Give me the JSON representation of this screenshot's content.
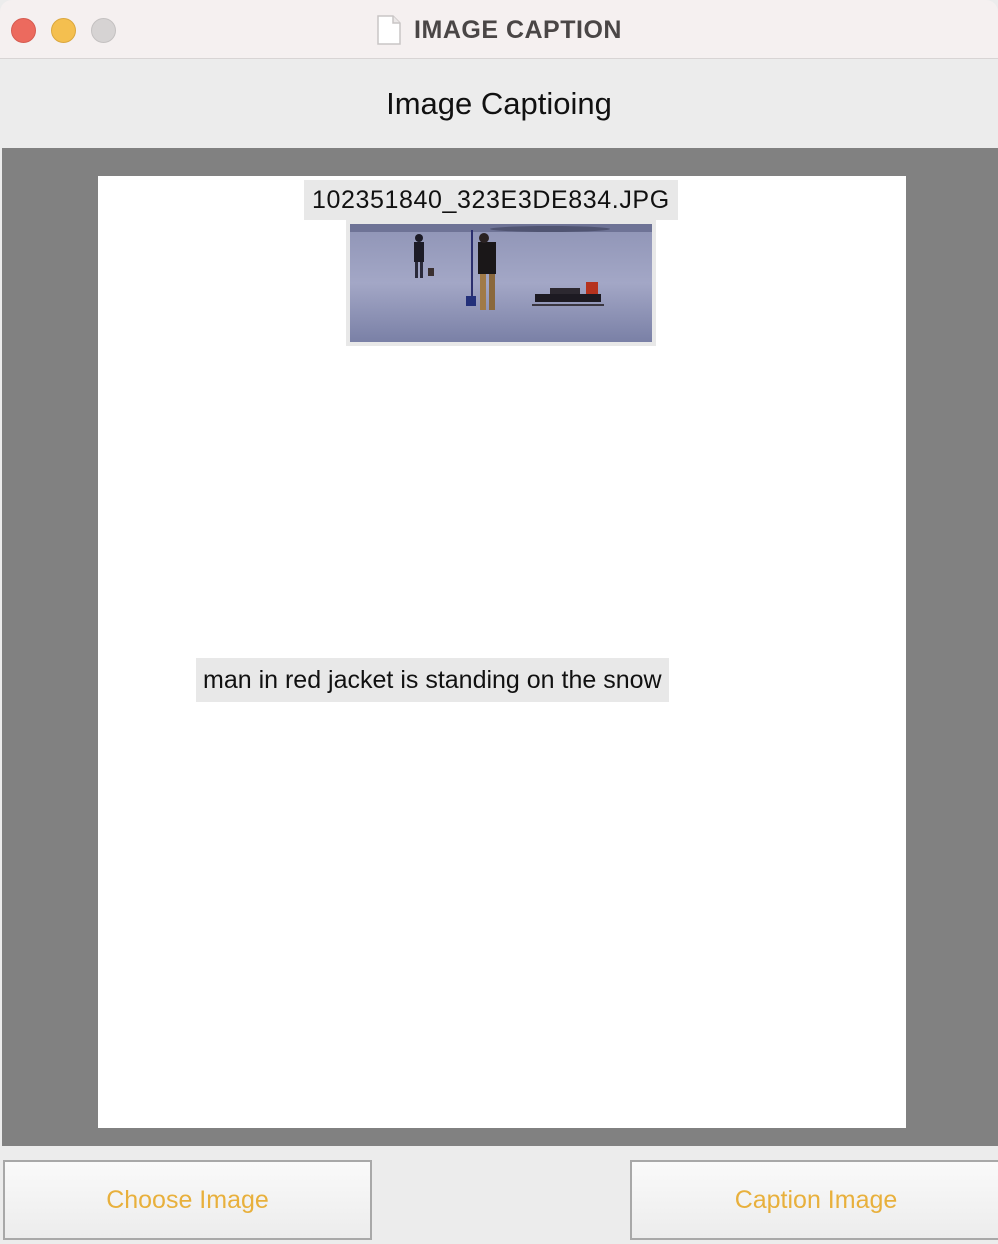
{
  "window": {
    "title": "IMAGE CAPTION",
    "doc_icon": "document-icon"
  },
  "app": {
    "heading": "Image Captioing"
  },
  "image": {
    "filename": "102351840_323E3DE834.JPG",
    "caption": "man in red jacket is standing on the snow"
  },
  "buttons": {
    "choose": "Choose Image",
    "caption": "Caption Image"
  },
  "colors": {
    "button_text": "#e8b03c",
    "panel_bg": "#818181",
    "close": "#ec6a5e",
    "minimize": "#f4bf4f",
    "zoom": "#d6d3d3"
  }
}
